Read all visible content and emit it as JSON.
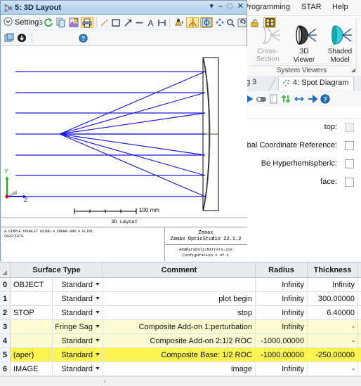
{
  "ribbon": {
    "menu": [
      {
        "label": "Programming"
      },
      {
        "label": "STAR"
      },
      {
        "label": "Help"
      }
    ],
    "group_name": "System Viewers",
    "buttons": [
      {
        "label": "Cross-Section",
        "icon": "cross-section-icon",
        "enabled": false
      },
      {
        "label": "3D\nViewer",
        "line1": "3D",
        "line2": "Viewer",
        "icon": "3d-viewer-icon",
        "enabled": true
      },
      {
        "label": "Shaded Model",
        "line1": "Shaded",
        "line2": "Model",
        "icon": "shaded-model-icon",
        "enabled": true
      }
    ]
  },
  "right_panel": {
    "tab_previous": "g 3",
    "tab_active": "4: Spot Diagram",
    "tab_icon": "spot-diagram-icon",
    "toolbar_icons": [
      "arrow-right-icon",
      "toggle-icon",
      "page-icon",
      "swap-vertical-icon",
      "expand-horizontal-icon",
      "arrow-forward-icon",
      "help-icon"
    ],
    "checkbox_rows": [
      {
        "label": "top:",
        "checked": false,
        "disabled": true
      },
      {
        "label": "lobal Coordinate Reference:",
        "checked": false,
        "disabled": false
      },
      {
        "label": "Be Hyperhemispheric:",
        "checked": false,
        "disabled": false
      },
      {
        "label": "face:",
        "checked": false,
        "disabled": false
      }
    ]
  },
  "layout_window": {
    "title": "5: 3D Layout",
    "window_icon": "layout-window-icon",
    "buttons": {
      "dropdown": "▾",
      "minimize": "–",
      "maximize": "□",
      "close": "✕"
    },
    "toolbar": {
      "settings_label": "Settings",
      "line_thickness_label": "Line Thickness",
      "icons_row1": [
        "refresh-icon",
        "copy-icon",
        "save-image-icon",
        "print-icon",
        "line-icon",
        "rectangle-icon",
        "arrow-icon",
        "dash-icon",
        "text-icon",
        "measure-icon",
        "rotate-icon",
        "axis-icon",
        "target-icon",
        "pan-icon",
        "zoom-icon",
        "undo-zoom-icon",
        "lock-icon",
        "fit-window-icon"
      ],
      "icons_row2": [
        "export-icon",
        "detach-icon",
        "help-icon"
      ]
    },
    "plot": {
      "scale_label": "100 mm",
      "figure_title": "3D Layout",
      "description_line1": "A SIMPLE DOUBLET USING A CROWN AND A FLINT.",
      "description_line2": "2022/10/9",
      "brand_line1": "Zemax",
      "brand_line2": "Zemax OpticStudio 22.1.2",
      "file_line1": "AddParabolicMirrors.zos",
      "file_line2": "Configuration 1 of 1",
      "axis_y_label": "Y",
      "axis_z_label": "Z"
    }
  },
  "table": {
    "columns": [
      "Surface Type",
      "Comment",
      "Radius",
      "Thickness"
    ],
    "rows": [
      {
        "num": "0",
        "name": "OBJECT",
        "type": "Standard",
        "comment": "",
        "radius": "Infinity",
        "thickness": "Infinity",
        "highlight": "none"
      },
      {
        "num": "1",
        "name": "",
        "type": "Standard",
        "comment": "plot begin",
        "radius": "Infinity",
        "thickness": "300.00000",
        "highlight": "none"
      },
      {
        "num": "2",
        "name": "STOP",
        "type": "Standard",
        "comment": "stop",
        "radius": "Infinity",
        "thickness": "6.40000",
        "highlight": "none"
      },
      {
        "num": "3",
        "name": "",
        "type": "Zernike Fringe Sag",
        "comment": "Composite Add-on 1:perturbation",
        "radius": "Infinity",
        "thickness": "-",
        "highlight": "light"
      },
      {
        "num": "4",
        "name": "",
        "type": "Standard",
        "comment": "Composite Add-on 2:1/2 ROC",
        "radius": "-1000.00000",
        "thickness": "-",
        "highlight": "light"
      },
      {
        "num": "5",
        "name": "(aper)",
        "type": "Standard",
        "comment": "Composite Base: 1/2 ROC",
        "radius": "-1000.00000",
        "thickness": "-250.00000",
        "highlight": "strong"
      },
      {
        "num": "6",
        "name": "IMAGE",
        "type": "Standard",
        "comment": "image",
        "radius": "Infinity",
        "thickness": "-",
        "highlight": "none"
      }
    ],
    "scroll_left_icon": "‹"
  },
  "colors": {
    "ray": "#1a1ae6",
    "highlight_light": "#fdfbd2",
    "highlight_strong": "#fcf451",
    "title_bar": "#bcd8ef",
    "accent_orange": "#e0a93b"
  }
}
